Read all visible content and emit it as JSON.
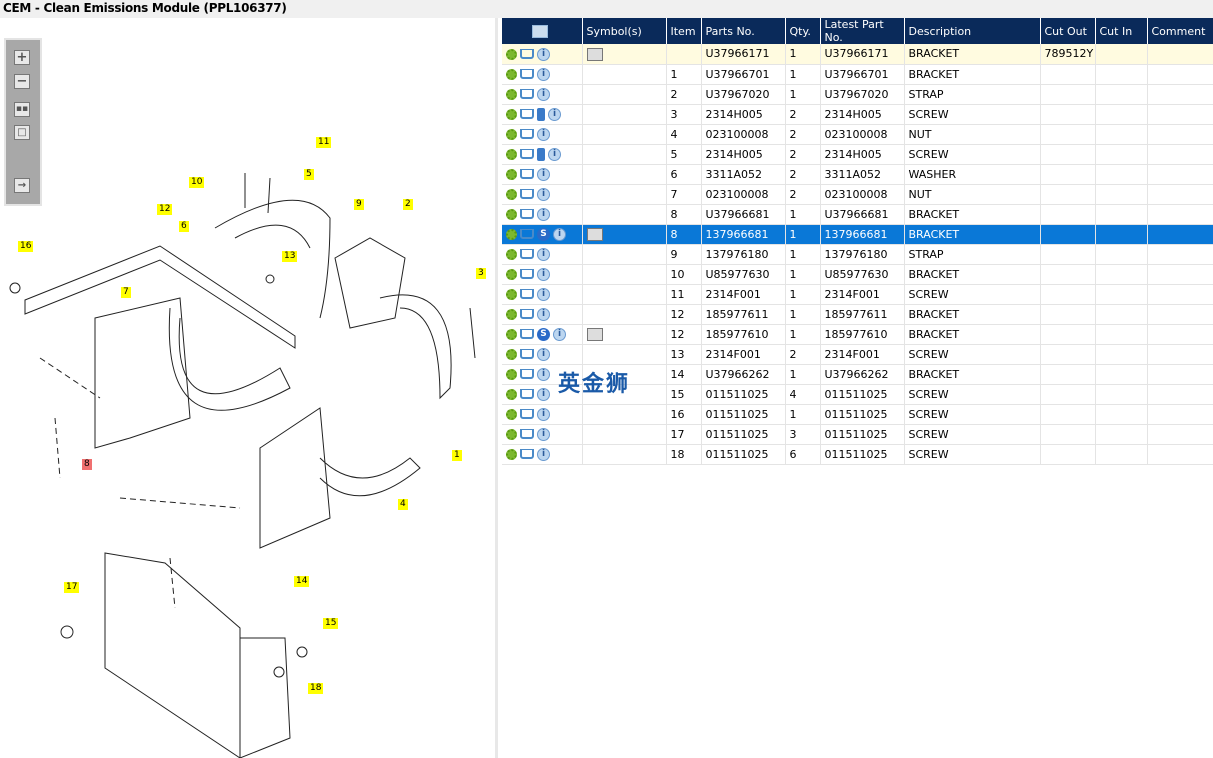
{
  "title": "CEM - Clean Emissions Module (PPL106377)",
  "toolbar": {
    "icons": [
      "zoom-in-icon",
      "zoom-out-icon",
      "fit-all-icon",
      "fit-window-icon",
      "export-icon"
    ]
  },
  "diagram": {
    "callouts": [
      "11",
      "10",
      "5",
      "12",
      "9",
      "2",
      "6",
      "13",
      "16",
      "7",
      "3",
      "8",
      "1",
      "4",
      "17",
      "14",
      "15",
      "18"
    ],
    "highlighted_callout": "8"
  },
  "watermark": "英金狮",
  "table": {
    "headers": [
      "",
      "Symbol(s)",
      "Item",
      "Parts No.",
      "Qty.",
      "Latest Part No.",
      "Description",
      "Cut Out",
      "Cut In",
      "Comment"
    ],
    "rows": [
      {
        "item": "",
        "part": "U37966171",
        "qty": "1",
        "latest": "U37966171",
        "desc": "BRACKET",
        "cut_out": "789512Y",
        "book": false,
        "s": false,
        "symbol": true
      },
      {
        "item": "1",
        "part": "U37966701",
        "qty": "1",
        "latest": "U37966701",
        "desc": "BRACKET",
        "cut_out": "",
        "book": false,
        "s": false,
        "symbol": false
      },
      {
        "item": "2",
        "part": "U37967020",
        "qty": "1",
        "latest": "U37967020",
        "desc": "STRAP",
        "cut_out": "",
        "book": false,
        "s": false,
        "symbol": false
      },
      {
        "item": "3",
        "part": "2314H005",
        "qty": "2",
        "latest": "2314H005",
        "desc": "SCREW",
        "cut_out": "",
        "book": true,
        "s": false,
        "symbol": false
      },
      {
        "item": "4",
        "part": "023100008",
        "qty": "2",
        "latest": "023100008",
        "desc": "NUT",
        "cut_out": "",
        "book": false,
        "s": false,
        "symbol": false
      },
      {
        "item": "5",
        "part": "2314H005",
        "qty": "2",
        "latest": "2314H005",
        "desc": "SCREW",
        "cut_out": "",
        "book": true,
        "s": false,
        "symbol": false
      },
      {
        "item": "6",
        "part": "3311A052",
        "qty": "2",
        "latest": "3311A052",
        "desc": "WASHER",
        "cut_out": "",
        "book": false,
        "s": false,
        "symbol": false
      },
      {
        "item": "7",
        "part": "023100008",
        "qty": "2",
        "latest": "023100008",
        "desc": "NUT",
        "cut_out": "",
        "book": false,
        "s": false,
        "symbol": false
      },
      {
        "item": "8",
        "part": "U37966681",
        "qty": "1",
        "latest": "U37966681",
        "desc": "BRACKET",
        "cut_out": "",
        "book": false,
        "s": false,
        "symbol": false
      },
      {
        "item": "8",
        "part": "137966681",
        "qty": "1",
        "latest": "137966681",
        "desc": "BRACKET",
        "cut_out": "",
        "book": false,
        "s": true,
        "symbol": true,
        "selected": true
      },
      {
        "item": "9",
        "part": "137976180",
        "qty": "1",
        "latest": "137976180",
        "desc": "STRAP",
        "cut_out": "",
        "book": false,
        "s": false,
        "symbol": false
      },
      {
        "item": "10",
        "part": "U85977630",
        "qty": "1",
        "latest": "U85977630",
        "desc": "BRACKET",
        "cut_out": "",
        "book": false,
        "s": false,
        "symbol": false
      },
      {
        "item": "11",
        "part": "2314F001",
        "qty": "1",
        "latest": "2314F001",
        "desc": "SCREW",
        "cut_out": "",
        "book": false,
        "s": false,
        "symbol": false
      },
      {
        "item": "12",
        "part": "185977611",
        "qty": "1",
        "latest": "185977611",
        "desc": "BRACKET",
        "cut_out": "",
        "book": false,
        "s": false,
        "symbol": false
      },
      {
        "item": "12",
        "part": "185977610",
        "qty": "1",
        "latest": "185977610",
        "desc": "BRACKET",
        "cut_out": "",
        "book": false,
        "s": true,
        "symbol": true
      },
      {
        "item": "13",
        "part": "2314F001",
        "qty": "2",
        "latest": "2314F001",
        "desc": "SCREW",
        "cut_out": "",
        "book": false,
        "s": false,
        "symbol": false
      },
      {
        "item": "14",
        "part": "U37966262",
        "qty": "1",
        "latest": "U37966262",
        "desc": "BRACKET",
        "cut_out": "",
        "book": false,
        "s": false,
        "symbol": false
      },
      {
        "item": "15",
        "part": "011511025",
        "qty": "4",
        "latest": "011511025",
        "desc": "SCREW",
        "cut_out": "",
        "book": false,
        "s": false,
        "symbol": false
      },
      {
        "item": "16",
        "part": "011511025",
        "qty": "1",
        "latest": "011511025",
        "desc": "SCREW",
        "cut_out": "",
        "book": false,
        "s": false,
        "symbol": false
      },
      {
        "item": "17",
        "part": "011511025",
        "qty": "3",
        "latest": "011511025",
        "desc": "SCREW",
        "cut_out": "",
        "book": false,
        "s": false,
        "symbol": false
      },
      {
        "item": "18",
        "part": "011511025",
        "qty": "6",
        "latest": "011511025",
        "desc": "SCREW",
        "cut_out": "",
        "book": false,
        "s": false,
        "symbol": false
      }
    ]
  }
}
